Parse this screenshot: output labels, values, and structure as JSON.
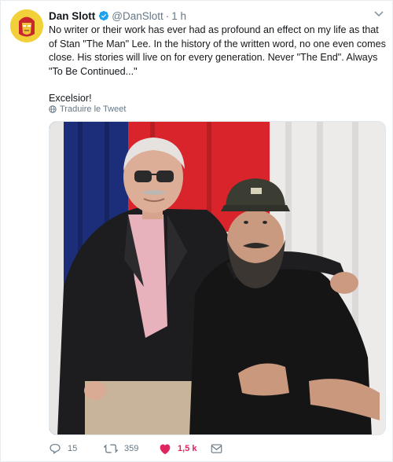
{
  "tweet": {
    "author_name": "Dan Slott",
    "author_handle": "@DanSlott",
    "separator": "·",
    "time": "1 h",
    "paragraph_1": "No writer or their work has ever had as profound an effect on my life as that of Stan \"The Man\" Lee. In the history of the written word, no one even comes close. His stories will live on for every generation. Never \"The End\". Always \"To Be Continued...\"",
    "paragraph_2": "Excelsior!",
    "translate_label": "Traduire le Tweet"
  },
  "actions": {
    "replies": "15",
    "retweets": "359",
    "likes": "1,5 k"
  },
  "colors": {
    "like": "#e0245e",
    "secondary_text": "#657786",
    "verified": "#1da1f2"
  },
  "icons": [
    "verified-badge-icon",
    "chevron-down-icon",
    "globe-icon",
    "reply-icon",
    "retweet-icon",
    "heart-icon",
    "message-icon"
  ]
}
